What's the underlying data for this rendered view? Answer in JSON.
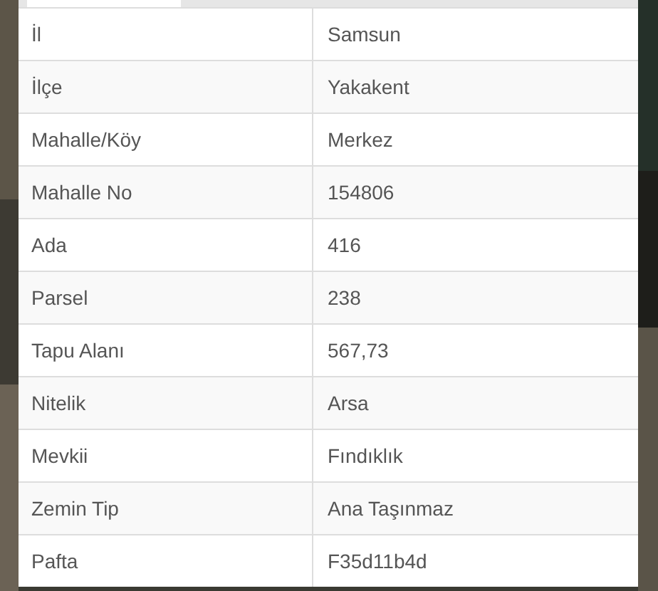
{
  "table": {
    "rows": [
      {
        "label": "İl",
        "value": "Samsun"
      },
      {
        "label": "İlçe",
        "value": "Yakakent"
      },
      {
        "label": "Mahalle/Köy",
        "value": "Merkez"
      },
      {
        "label": "Mahalle No",
        "value": "154806"
      },
      {
        "label": "Ada",
        "value": "416"
      },
      {
        "label": "Parsel",
        "value": "238"
      },
      {
        "label": "Tapu Alanı",
        "value": "567,73"
      },
      {
        "label": "Nitelik",
        "value": "Arsa"
      },
      {
        "label": "Mevkii",
        "value": "Fındıklık"
      },
      {
        "label": "Zemin Tip",
        "value": "Ana Taşınmaz"
      },
      {
        "label": "Pafta",
        "value": "F35d11b4d"
      }
    ]
  }
}
